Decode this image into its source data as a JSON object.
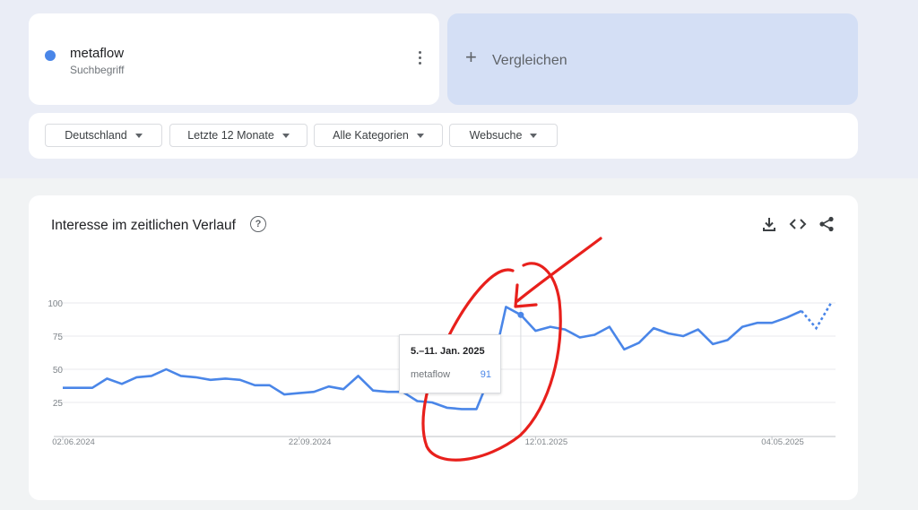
{
  "search_term": {
    "name": "metaflow",
    "type_label": "Suchbegriff",
    "color": "#4a86e8"
  },
  "compare": {
    "label": "Vergleichen"
  },
  "filters": [
    {
      "label": "Deutschland"
    },
    {
      "label": "Letzte 12 Monate"
    },
    {
      "label": "Alle Kategorien"
    },
    {
      "label": "Websuche"
    }
  ],
  "chart_panel": {
    "title": "Interesse im zeitlichen Verlauf",
    "tools": [
      "download-icon",
      "embed-code-icon",
      "share-icon"
    ]
  },
  "tooltip": {
    "date": "5.–11. Jan. 2025",
    "term": "metaflow",
    "value": "91"
  },
  "chart_data": {
    "type": "line",
    "title": "Interesse im zeitlichen Verlauf",
    "xlabel": "",
    "ylabel": "",
    "ylim": [
      0,
      100
    ],
    "yticks": [
      25,
      50,
      75,
      100
    ],
    "xtick_labels": [
      "02.06.2024",
      "22.09.2024",
      "12.01.2025",
      "04.05.2025"
    ],
    "xtick_indices": [
      0,
      16,
      32,
      48
    ],
    "grid": true,
    "legend": "none",
    "series": [
      {
        "color": "#4a86e8",
        "values": [
          36,
          36,
          36,
          43,
          39,
          44,
          45,
          50,
          45,
          44,
          42,
          43,
          42,
          38,
          38,
          31,
          32,
          33,
          37,
          35,
          45,
          34,
          33,
          33,
          26,
          25,
          21,
          20,
          20,
          47,
          97,
          91,
          79,
          82,
          80,
          74,
          76,
          82,
          65,
          70,
          81,
          77,
          75,
          80,
          69,
          72,
          82,
          85,
          85,
          89,
          94,
          81,
          100
        ],
        "partial_last_points": 2
      }
    ]
  },
  "annotation": {
    "color": "#e8201c",
    "kind": "hand-drawn circle and arrow"
  }
}
